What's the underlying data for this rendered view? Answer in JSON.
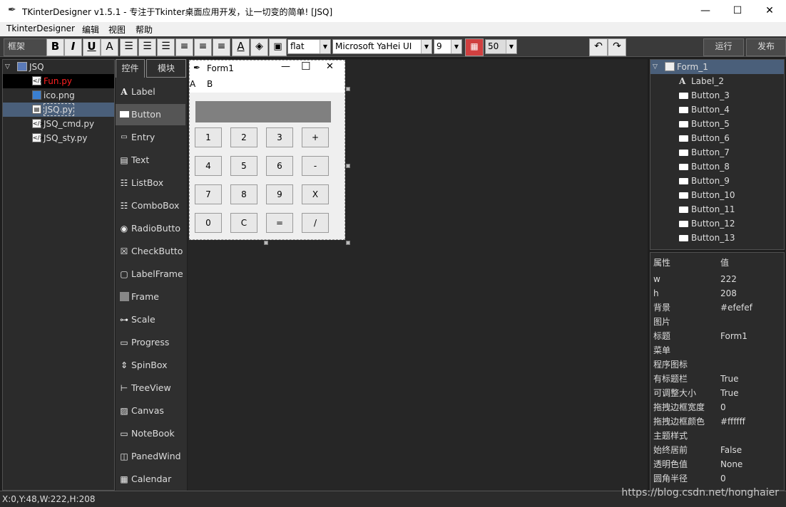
{
  "window": {
    "title": "TKinterDesigner v1.5.1 - 专注于Tkinter桌面应用开发，让一切变的简单!    [JSQ]",
    "minimize": "—",
    "maximize": "☐",
    "close": "✕"
  },
  "menubar": {
    "items": [
      "TkinterDesigner",
      "编辑",
      "视图",
      "帮助"
    ]
  },
  "toolbar": {
    "frame_label": "框架",
    "bold": "B",
    "italic": "I",
    "underline": "U",
    "font_A": "A",
    "relief": "flat",
    "font_family": "Microsoft YaHei UI",
    "font_size": "9",
    "alpha": "50",
    "run": "运行",
    "publish": "发布"
  },
  "project": {
    "root": "JSQ",
    "files": [
      {
        "name": "Fun.py",
        "state": "highlighted"
      },
      {
        "name": "ico.png",
        "state": "normal"
      },
      {
        "name": "JSQ.py",
        "state": "selected"
      },
      {
        "name": "JSQ_cmd.py",
        "state": "normal"
      },
      {
        "name": "JSQ_sty.py",
        "state": "normal"
      }
    ]
  },
  "palette": {
    "tabs": [
      "控件",
      "模块"
    ],
    "items": [
      "Label",
      "Button",
      "Entry",
      "Text",
      "ListBox",
      "ComboBox",
      "RadioButto",
      "CheckButto",
      "LabelFrame",
      "Frame",
      "Scale",
      "Progress",
      "SpinBox",
      "TreeView",
      "Canvas",
      "NoteBook",
      "PanedWind",
      "Calendar"
    ],
    "selected": "Button"
  },
  "form": {
    "title": "Form1",
    "menu": [
      "A",
      "B"
    ],
    "buttons": [
      "1",
      "2",
      "3",
      "+",
      "4",
      "5",
      "6",
      "-",
      "7",
      "8",
      "9",
      "X",
      "0",
      "C",
      "=",
      "/"
    ]
  },
  "object_tree": {
    "root": "Form_1",
    "items": [
      "Label_2",
      "Button_3",
      "Button_4",
      "Button_5",
      "Button_6",
      "Button_7",
      "Button_8",
      "Button_9",
      "Button_10",
      "Button_11",
      "Button_12",
      "Button_13"
    ]
  },
  "properties": {
    "header_key": "属性",
    "header_value": "值",
    "rows": [
      {
        "k": "w",
        "v": "222"
      },
      {
        "k": "h",
        "v": "208"
      },
      {
        "k": "背景",
        "v": "#efefef"
      },
      {
        "k": "图片",
        "v": ""
      },
      {
        "k": "标题",
        "v": "Form1"
      },
      {
        "k": "菜单",
        "v": ""
      },
      {
        "k": "程序图标",
        "v": ""
      },
      {
        "k": "有标题栏",
        "v": "True"
      },
      {
        "k": "可调整大小",
        "v": "True"
      },
      {
        "k": "拖拽边框宽度",
        "v": "0"
      },
      {
        "k": "拖拽边框颜色",
        "v": "#ffffff"
      },
      {
        "k": "主题样式",
        "v": ""
      },
      {
        "k": "始终居前",
        "v": "False"
      },
      {
        "k": "透明色值",
        "v": "None"
      },
      {
        "k": "圆角半径",
        "v": "0"
      }
    ]
  },
  "status": {
    "text": "X:0,Y:48,W:222,H:208",
    "watermark": "https://blog.csdn.net/honghaier"
  }
}
